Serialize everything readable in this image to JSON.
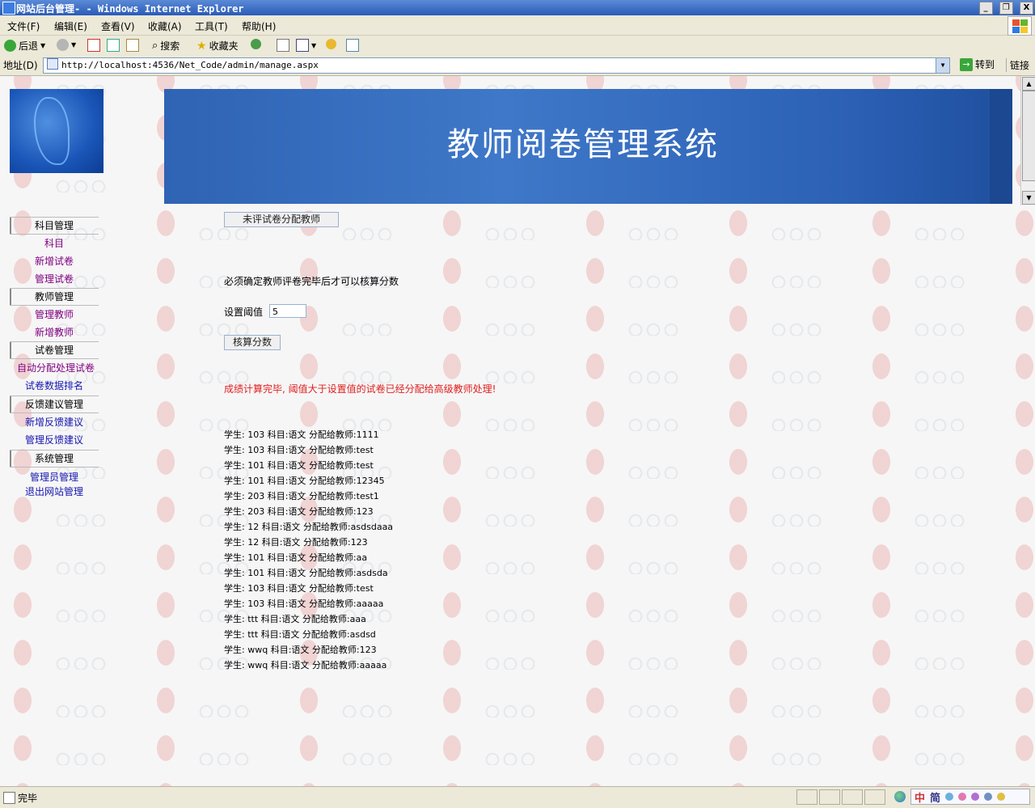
{
  "window": {
    "title": "网站后台管理- - Windows Internet Explorer",
    "buttons": [
      "_",
      "❐",
      "X"
    ]
  },
  "menubar": {
    "items": [
      "文件(F)",
      "编辑(E)",
      "查看(V)",
      "收藏(A)",
      "工具(T)",
      "帮助(H)"
    ]
  },
  "toolbar": {
    "back": "后退",
    "search": "搜索",
    "favorites": "收藏夹"
  },
  "address": {
    "label": "地址(D)",
    "url": "http://localhost:4536/Net_Code/admin/manage.aspx",
    "go": "转到",
    "links": "链接"
  },
  "header": {
    "title": "教师阅卷管理系统"
  },
  "sidebar": {
    "sections": [
      {
        "label": "科目管理",
        "items": [
          {
            "label": "科目",
            "visited": true
          },
          {
            "label": "新增试卷",
            "visited": true
          },
          {
            "label": "管理试卷",
            "visited": true
          }
        ]
      },
      {
        "label": "教师管理",
        "items": [
          {
            "label": "管理教师",
            "visited": true
          },
          {
            "label": "新增教师",
            "visited": true
          }
        ]
      },
      {
        "label": "试卷管理",
        "items": [
          {
            "label": "自动分配处理试卷",
            "visited": true
          },
          {
            "label": "试卷数据排名",
            "visited": false
          }
        ]
      },
      {
        "label": "反馈建议管理",
        "items": [
          {
            "label": "新增反馈建议",
            "visited": false
          },
          {
            "label": "管理反馈建议",
            "visited": false
          }
        ]
      },
      {
        "label": "系统管理",
        "items": [
          {
            "label": "管理员管理",
            "visited": false
          },
          {
            "label": "退出网站管理",
            "visited": false
          }
        ]
      }
    ]
  },
  "main": {
    "assign_button": "未评试卷分配教师",
    "notice": "必须确定教师评卷完毕后才可以核算分数",
    "threshold_label": "设置阈值",
    "threshold_value": "5",
    "calc_button": "核算分数",
    "result_message": "成绩计算完毕, 阈值大于设置值的试卷已经分配给高级教师处理!",
    "assignments": [
      {
        "student": "103",
        "subject": "语文",
        "teacher": "1111"
      },
      {
        "student": "103",
        "subject": "语文",
        "teacher": "test"
      },
      {
        "student": "101",
        "subject": "语文",
        "teacher": "test"
      },
      {
        "student": "101",
        "subject": "语文",
        "teacher": "12345"
      },
      {
        "student": "203",
        "subject": "语文",
        "teacher": "test1"
      },
      {
        "student": "203",
        "subject": "语文",
        "teacher": "123"
      },
      {
        "student": "12",
        "subject": "语文",
        "teacher": "asdsdaaa"
      },
      {
        "student": "12",
        "subject": "语文",
        "teacher": "123"
      },
      {
        "student": "101",
        "subject": "语文",
        "teacher": "aa"
      },
      {
        "student": "101",
        "subject": "语文",
        "teacher": "asdsda"
      },
      {
        "student": "103",
        "subject": "语文",
        "teacher": "test"
      },
      {
        "student": "103",
        "subject": "语文",
        "teacher": "aaaaa"
      },
      {
        "student": "ttt",
        "subject": "语文",
        "teacher": "aaa"
      },
      {
        "student": "ttt",
        "subject": "语文",
        "teacher": "asdsd"
      },
      {
        "student": "wwq",
        "subject": "语文",
        "teacher": "123"
      },
      {
        "student": "wwq",
        "subject": "语文",
        "teacher": "aaaaa"
      }
    ],
    "row_labels": {
      "student": "学生:",
      "subject": "科目:",
      "teacher": "分配给教师:"
    }
  },
  "statusbar": {
    "text": "完毕",
    "ime_zh": "中",
    "ime_jian": "简"
  },
  "colors": {
    "banner": "#2f63b4",
    "link": "#1515b0",
    "visited_link": "#800080",
    "result_message": "#e02020"
  }
}
